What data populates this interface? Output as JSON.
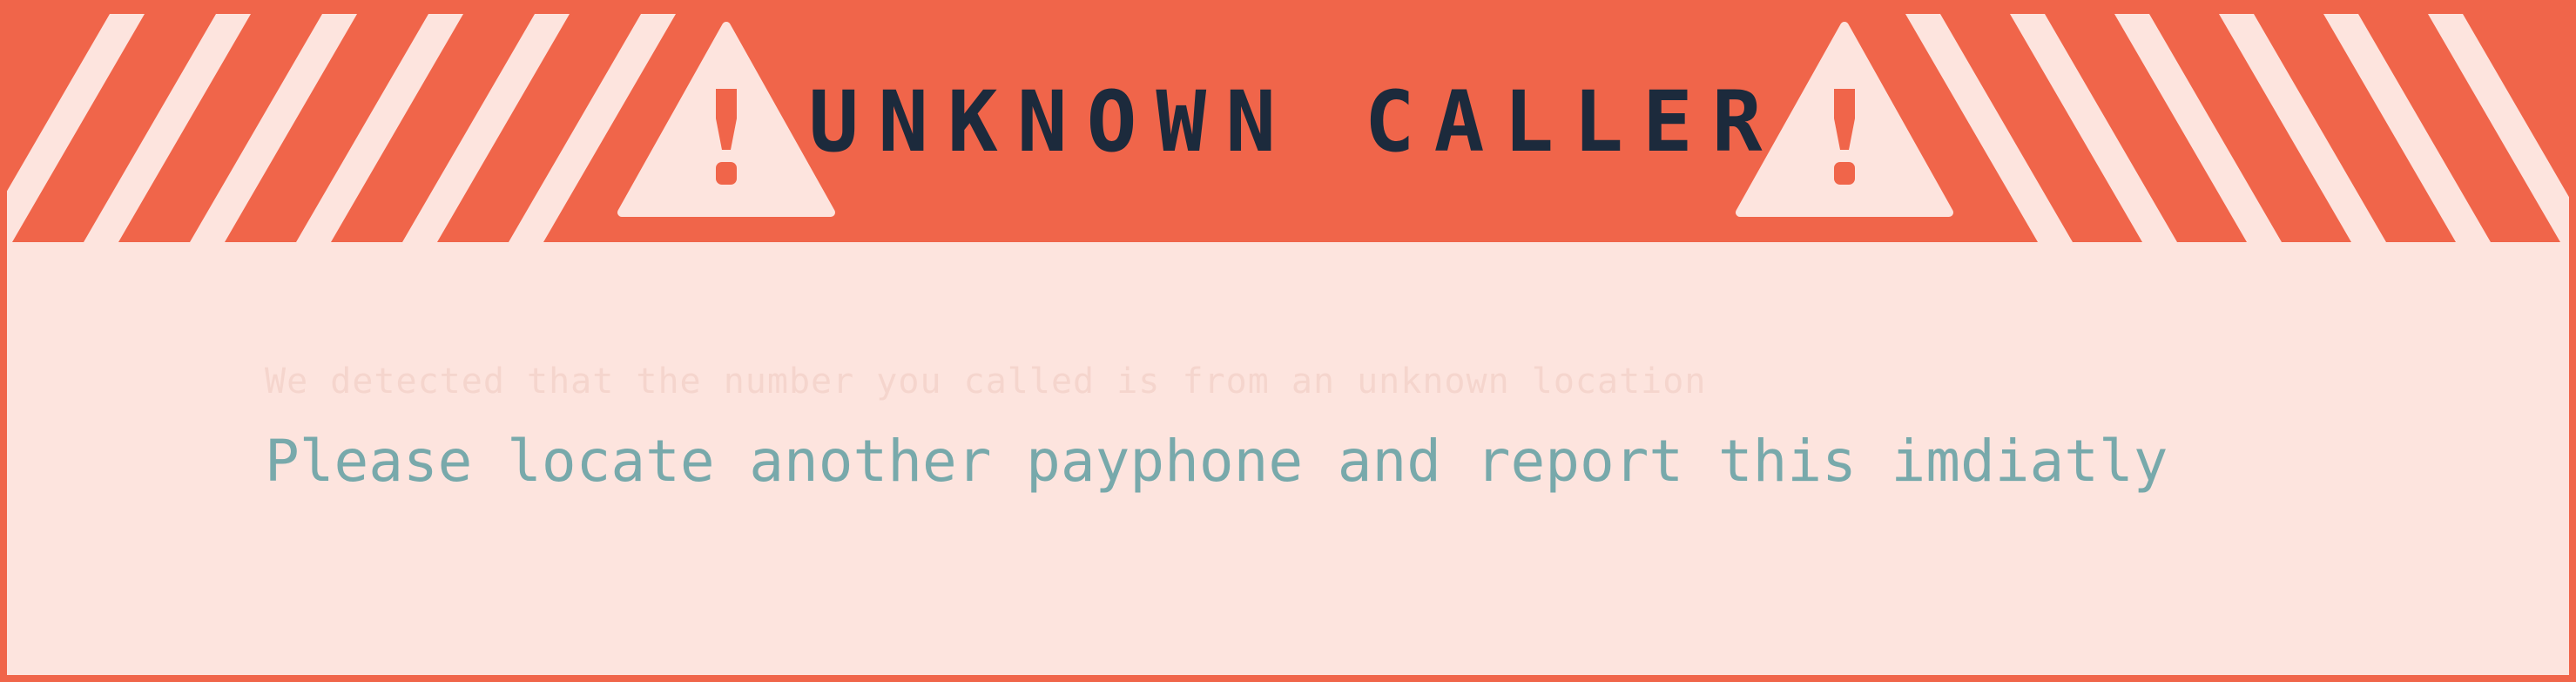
{
  "alert": {
    "title": "UNKNOWN CALLER",
    "faded_line": "We detected that the number you called is from an unknown location",
    "message": "Please locate another payphone and report this imdiatly"
  },
  "icons": {
    "left": "warning-triangle-icon",
    "right": "warning-triangle-icon"
  },
  "colors": {
    "accent": "#f0654a",
    "background": "#fde4de",
    "stripe": "#fde4de",
    "title": "#1c2a3c",
    "message": "#78a9ab"
  }
}
